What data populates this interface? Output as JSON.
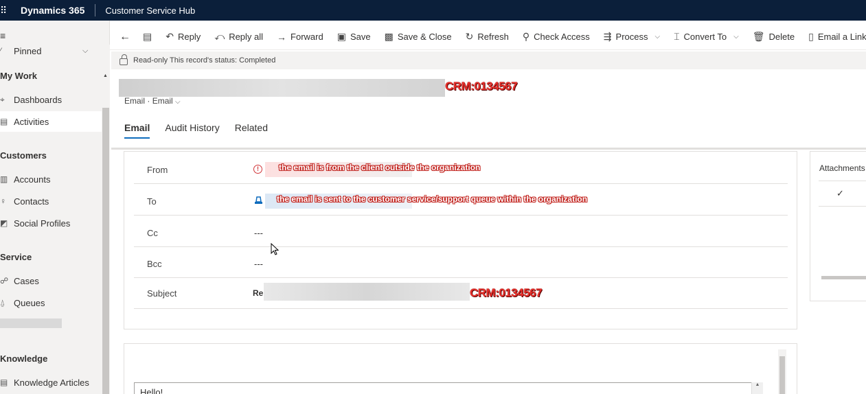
{
  "topbar": {
    "waffle_icon": "waffle-icon",
    "app_name": "Dynamics 365",
    "hub_name": "Customer Service Hub"
  },
  "sidebar": {
    "menu_icon": "hamburger-icon",
    "pinned_label": "Pinned",
    "sections": [
      {
        "title": "My Work",
        "items": [
          {
            "label": "Dashboards",
            "icon": "dashboard-icon"
          },
          {
            "label": "Activities",
            "icon": "activities-icon",
            "active": true
          }
        ]
      },
      {
        "title": "Customers",
        "items": [
          {
            "label": "Accounts",
            "icon": "accounts-icon"
          },
          {
            "label": "Contacts",
            "icon": "contacts-icon"
          },
          {
            "label": "Social Profiles",
            "icon": "social-profiles-icon"
          }
        ]
      },
      {
        "title": "Service",
        "items": [
          {
            "label": "Cases",
            "icon": "cases-icon"
          },
          {
            "label": "Queues",
            "icon": "queues-icon"
          }
        ]
      },
      {
        "title": "Knowledge",
        "items": [
          {
            "label": "Knowledge Articles",
            "icon": "knowledge-icon"
          }
        ]
      }
    ]
  },
  "commands": {
    "reply": "Reply",
    "reply_all": "Reply all",
    "forward": "Forward",
    "save": "Save",
    "save_close": "Save & Close",
    "refresh": "Refresh",
    "check_access": "Check Access",
    "process": "Process",
    "convert_to": "Convert To",
    "delete": "Delete",
    "email_link": "Email a Link"
  },
  "notice": {
    "text": "Read-only This record's status: Completed"
  },
  "record": {
    "crm_tag": "CRM:0134567",
    "entity": "Email",
    "form": "Email",
    "tabs": [
      "Email",
      "Audit History",
      "Related"
    ]
  },
  "form": {
    "from_label": "From",
    "from_annotation": "the email is from the client outside the organization",
    "to_label": "To",
    "to_annotation": "the email is sent to the customer service/support queue within the organization",
    "cc_label": "Cc",
    "cc_value": "---",
    "bcc_label": "Bcc",
    "bcc_value": "---",
    "subject_label": "Subject",
    "subject_prefix": "Re:",
    "subject_crm": "CRM:0134567"
  },
  "attachments": {
    "title": "Attachments"
  },
  "body": {
    "text": "Hello!"
  }
}
